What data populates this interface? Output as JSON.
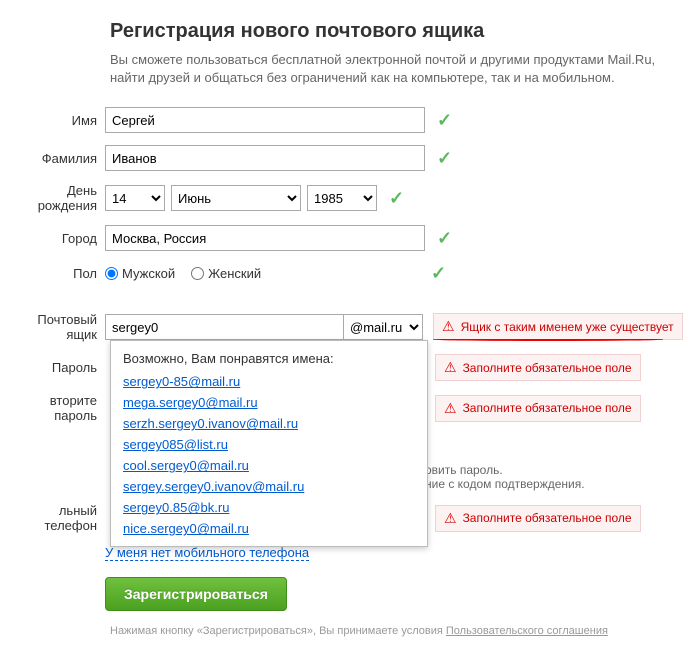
{
  "heading": "Регистрация нового почтового ящика",
  "subtext": "Вы сможете пользоваться бесплатной электронной почтой и другими продуктами Mail.Ru, найти друзей и общаться без ограничений как на компьютере, так и на мобильном.",
  "labels": {
    "firstname": "Имя",
    "lastname": "Фамилия",
    "birthday": "День рождения",
    "city": "Город",
    "gender": "Пол",
    "mailbox": "Почтовый ящик",
    "password": "Пароль",
    "password2": "вторите пароль",
    "phone": "льный телефон"
  },
  "values": {
    "firstname": "Сергей",
    "lastname": "Иванов",
    "day": "14",
    "month": "Июнь",
    "year": "1985",
    "city": "Москва, Россия",
    "mailbox": "sergey0",
    "domain": "@mail.ru"
  },
  "gender": {
    "male": "Мужской",
    "female": "Женский"
  },
  "errors": {
    "mailbox_exists": "Ящик с таким именем уже существует",
    "required": "Заполните обязательное поле"
  },
  "suggest": {
    "title": "Возможно, Вам понравятся имена:",
    "items": [
      "sergey0-85@mail.ru",
      "mega.sergey0@mail.ru",
      "serzh.sergey0.ivanov@mail.ru",
      "sergey085@list.ru",
      "cool.sergey0@mail.ru",
      "sergey.sergey0.ivanov@mail.ru",
      "sergey0.85@bk.ru",
      "nice.sergey0@mail.ru"
    ]
  },
  "hints": {
    "recover1": "овить пароль.",
    "recover2": "ние с кодом подтверждения."
  },
  "links": {
    "no_phone": "У меня нет мобильного телефона",
    "agreement": "Пользовательского соглашения"
  },
  "submit": "Зарегистрироваться",
  "footer": "Нажимая кнопку «Зарегистрироваться», Вы принимаете условия "
}
